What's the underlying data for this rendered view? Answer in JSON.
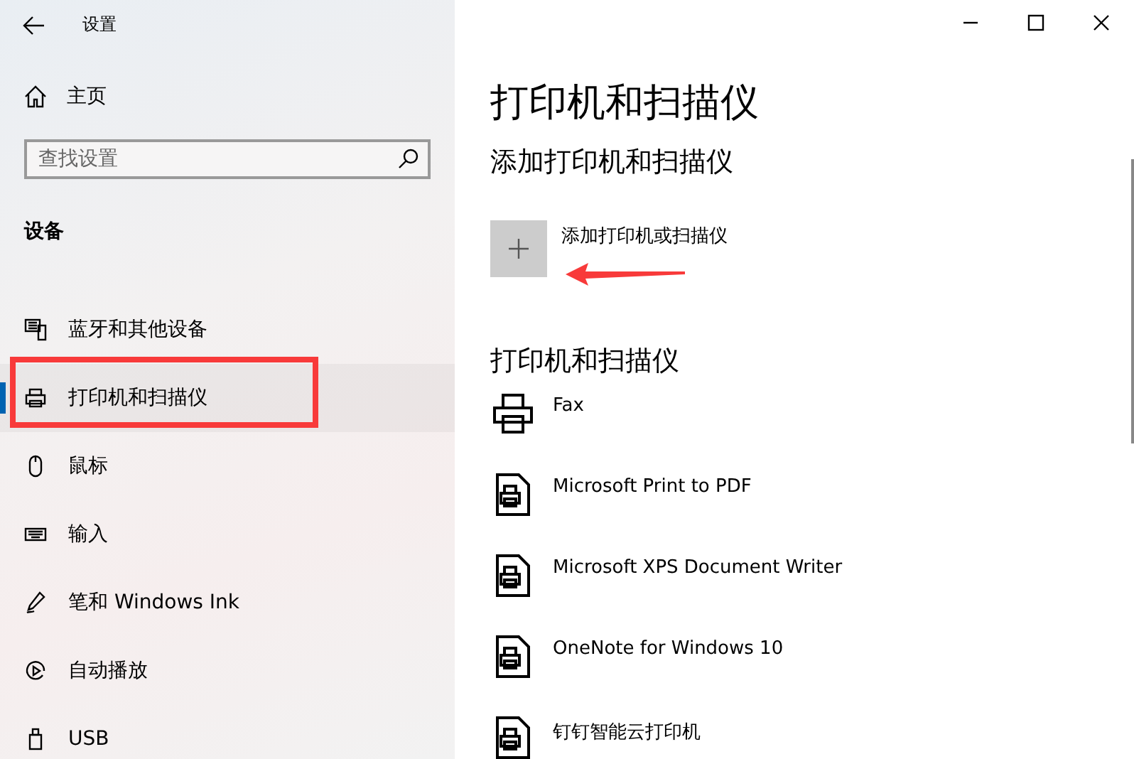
{
  "window": {
    "title": "设置"
  },
  "sidebar": {
    "home": "主页",
    "search": {
      "placeholder": "查找设置"
    },
    "section": "设备",
    "items": [
      {
        "label": "蓝牙和其他设备",
        "kind": "bluetooth",
        "selected": false
      },
      {
        "label": "打印机和扫描仪",
        "kind": "printer",
        "selected": true
      },
      {
        "label": "鼠标",
        "kind": "mouse",
        "selected": false
      },
      {
        "label": "输入",
        "kind": "keyboard",
        "selected": false
      },
      {
        "label": "笔和 Windows Ink",
        "kind": "pen",
        "selected": false
      },
      {
        "label": "自动播放",
        "kind": "autoplay",
        "selected": false
      },
      {
        "label": "USB",
        "kind": "usb",
        "selected": false
      }
    ]
  },
  "main": {
    "title": "打印机和扫描仪",
    "add_heading": "添加打印机和扫描仪",
    "add_button": "添加打印机或扫描仪",
    "list_heading": "打印机和扫描仪",
    "devices": [
      {
        "name": "Fax",
        "kind": "fax"
      },
      {
        "name": "Microsoft Print to PDF",
        "kind": "document"
      },
      {
        "name": "Microsoft XPS Document Writer",
        "kind": "document"
      },
      {
        "name": "OneNote for Windows 10",
        "kind": "document"
      },
      {
        "name": "钉钉智能云打印机",
        "kind": "document"
      }
    ]
  }
}
